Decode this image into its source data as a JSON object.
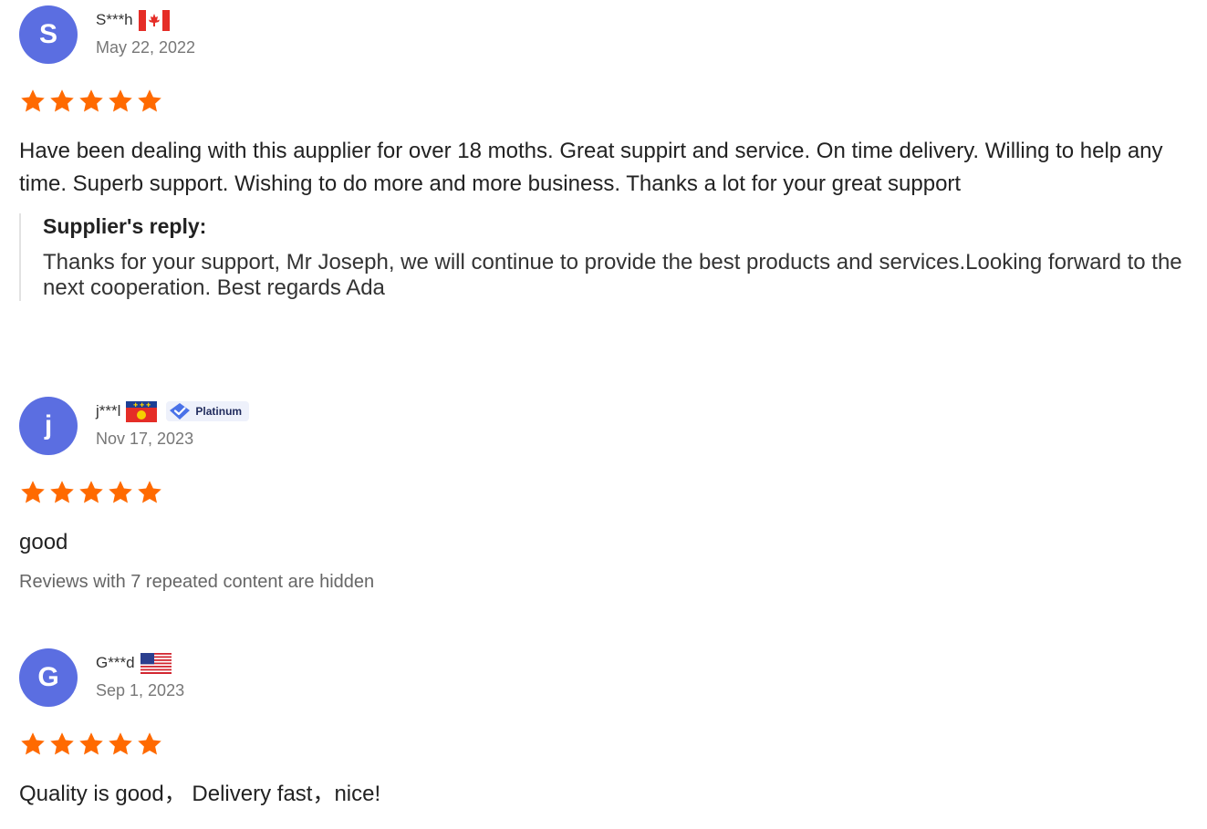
{
  "reviews": [
    {
      "avatar_letter": "S",
      "username": "S***h",
      "flag": "canada-flag",
      "date": "May 22, 2022",
      "rating": 5,
      "text": "Have been dealing with this aupplier for over 18 moths. Great suppirt and service. On time delivery. Willing to help any time. Superb support. Wishing to do more and more business. Thanks a lot for your great support",
      "reply_title": "Supplier's reply:",
      "reply_text": "Thanks for your support, Mr Joseph, we will continue to provide the best products and services.Looking forward to the next cooperation. Best regards Ada"
    },
    {
      "avatar_letter": "j",
      "username": "j***l",
      "flag": "guadeloupe-flag",
      "badge": "Platinum",
      "date": "Nov 17, 2023",
      "rating": 5,
      "text": "good",
      "hidden_note": "Reviews with 7 repeated content are hidden"
    },
    {
      "avatar_letter": "G",
      "username": "G***d",
      "flag": "usa-flag",
      "date": "Sep 1, 2023",
      "rating": 5,
      "text": "Quality is good， Delivery fast，nice!"
    }
  ],
  "colors": {
    "avatar": "#5b6ee1",
    "star": "#ff6a00",
    "badge_bg": "#eef1fb",
    "badge_check": "#4a72e8"
  },
  "icons": {
    "star": "star-icon",
    "badge": "verified-check-icon"
  }
}
